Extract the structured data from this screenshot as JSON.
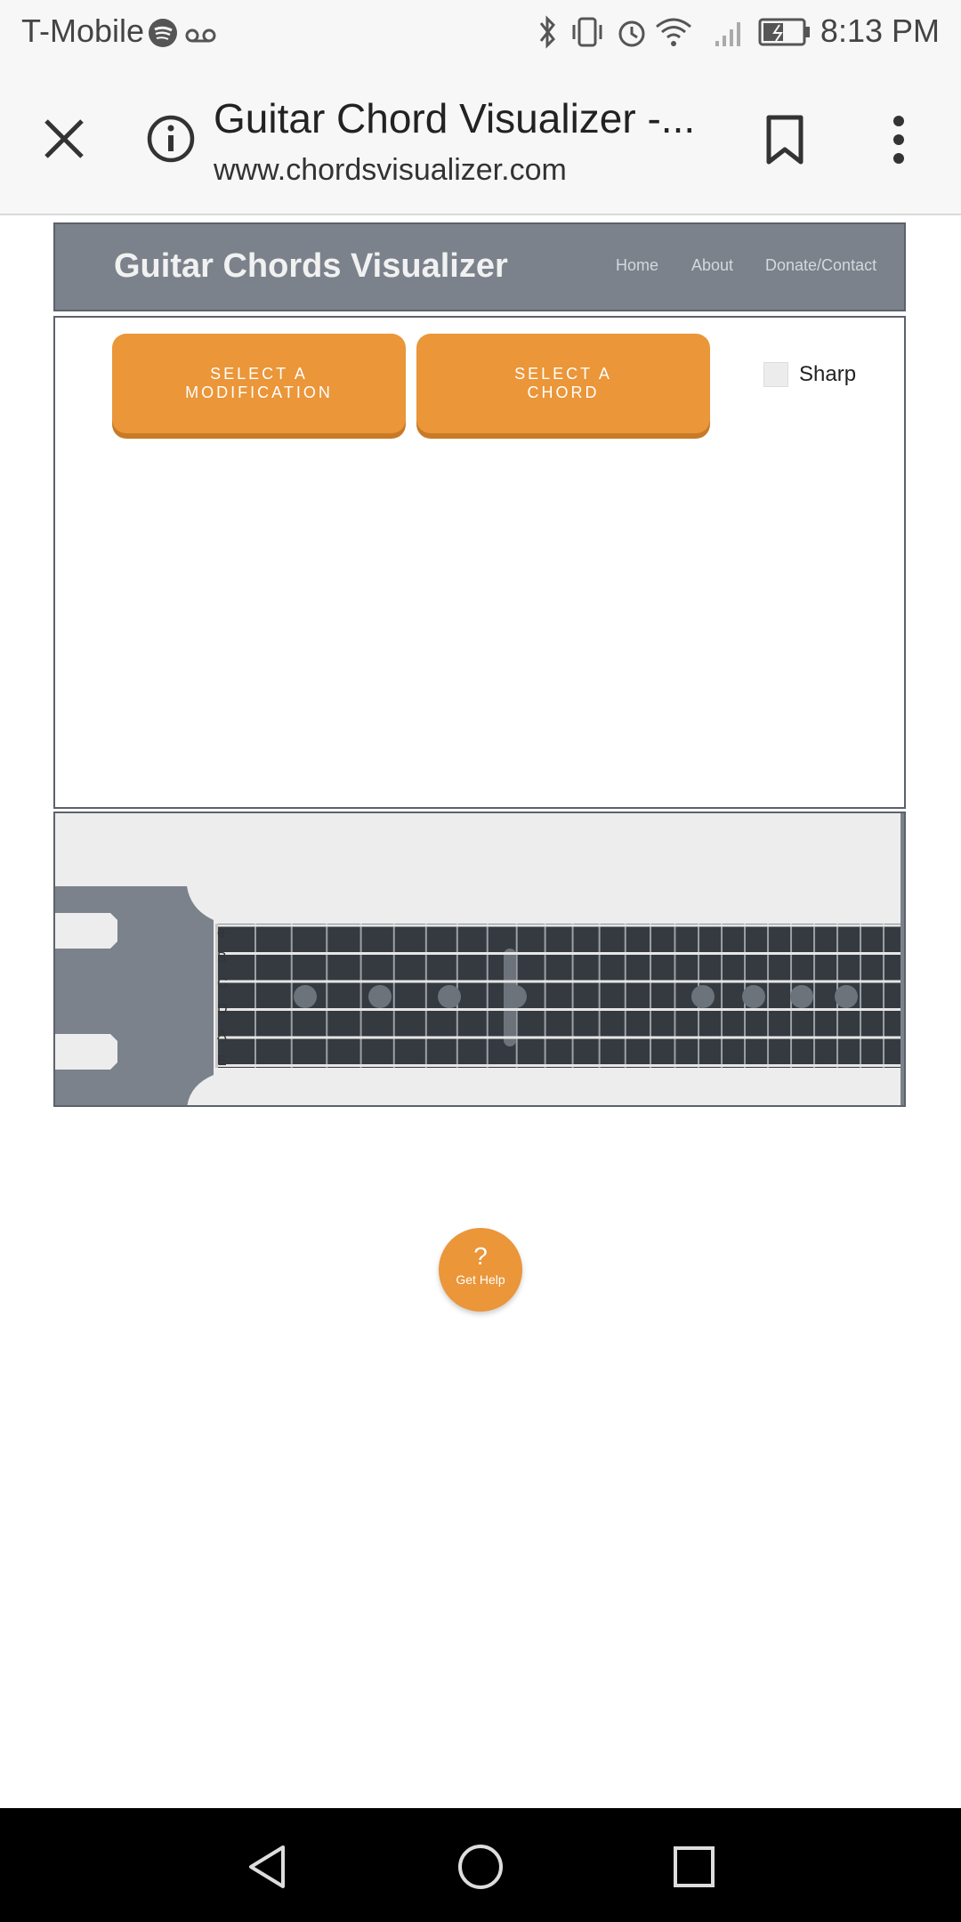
{
  "status_bar": {
    "carrier": "T-Mobile",
    "time": "8:13 PM",
    "icons": [
      "spotify-icon",
      "voicemail-icon",
      "bluetooth-icon",
      "vibrate-icon",
      "alarm-icon",
      "wifi-icon",
      "signal-icon",
      "battery-icon"
    ]
  },
  "browser": {
    "page_title": "Guitar Chord Visualizer -...",
    "url": "www.chordsvisualizer.com",
    "icons": [
      "close-icon",
      "info-icon",
      "bookmark-icon",
      "more-icon"
    ]
  },
  "site": {
    "title": "Guitar Chords Visualizer",
    "nav": {
      "home": "Home",
      "about": "About",
      "contact": "Donate/Contact"
    }
  },
  "controls": {
    "modification_button": "SELECT A\nMODIFICATION",
    "chord_button": "SELECT A\nCHORD",
    "sharp_label": "Sharp"
  },
  "guitar": {
    "strings": [
      "e",
      "B",
      "G",
      "D",
      "A",
      "E"
    ],
    "colors": {
      "headstock": "#7b828c",
      "fretboard": "#343a40",
      "frets": "#9aa0a6",
      "strings": "#e6e6e6"
    }
  },
  "help": {
    "symbol": "?",
    "label": "Get Help"
  },
  "colors": {
    "accent": "#ea9639",
    "header": "#7b828c"
  }
}
